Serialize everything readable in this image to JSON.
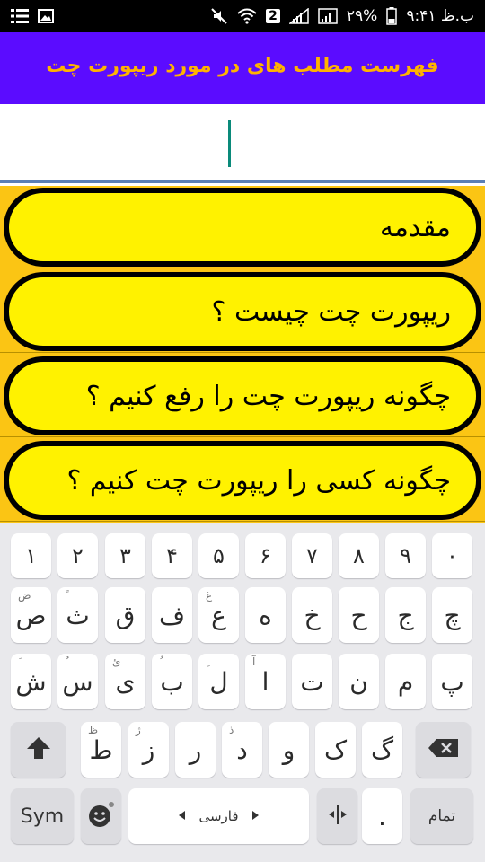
{
  "status_bar": {
    "time": "۹:۴۱ ب.ظ",
    "battery": "۲۹%",
    "sim_badge": "2"
  },
  "header": {
    "title": "فهرست مطلب های در مورد ریپورت چت"
  },
  "search": {
    "value": "",
    "placeholder": ""
  },
  "list": {
    "items": [
      {
        "label": "مقدمه"
      },
      {
        "label": "ریپورت چت چیست ؟"
      },
      {
        "label": "چگونه ریپورت چت را رفع کنیم ؟"
      },
      {
        "label": "چگونه کسی را ریپورت چت کنیم ؟"
      }
    ]
  },
  "keyboard": {
    "digits": [
      "۱",
      "۲",
      "۳",
      "۴",
      "۵",
      "۶",
      "۷",
      "۸",
      "۹",
      "۰"
    ],
    "row1": [
      {
        "main": "ص",
        "sub": "ض"
      },
      {
        "main": "ث",
        "sub": "ً"
      },
      {
        "main": "ق",
        "sub": ""
      },
      {
        "main": "ف",
        "sub": ""
      },
      {
        "main": "ع",
        "sub": "غ"
      },
      {
        "main": "ه",
        "sub": ""
      },
      {
        "main": "خ",
        "sub": ""
      },
      {
        "main": "ح",
        "sub": ""
      },
      {
        "main": "ج",
        "sub": ""
      },
      {
        "main": "چ",
        "sub": ""
      }
    ],
    "row2": [
      {
        "main": "ش",
        "sub": "َ"
      },
      {
        "main": "س",
        "sub": "ٌ"
      },
      {
        "main": "ی",
        "sub": "ئ"
      },
      {
        "main": "ب",
        "sub": "ُ"
      },
      {
        "main": "ل",
        "sub": "ِ"
      },
      {
        "main": "ا",
        "sub": "آ"
      },
      {
        "main": "ت",
        "sub": ""
      },
      {
        "main": "ن",
        "sub": ""
      },
      {
        "main": "م",
        "sub": ""
      },
      {
        "main": "پ",
        "sub": ""
      }
    ],
    "row3": [
      {
        "main": "ط",
        "sub": "ظ"
      },
      {
        "main": "ز",
        "sub": "ژ"
      },
      {
        "main": "ر",
        "sub": ""
      },
      {
        "main": "د",
        "sub": "ذ"
      },
      {
        "main": "و",
        "sub": ""
      },
      {
        "main": "ک",
        "sub": ""
      },
      {
        "main": "گ",
        "sub": ""
      }
    ],
    "sym_label": "Sym",
    "space_label": "فارسی",
    "period_label": ".",
    "done_label": "تمام"
  },
  "colors": {
    "title_bar": "#5b0cff",
    "title_text": "#ffb300",
    "list_background": "#fbc514",
    "pill_fill": "#fff200",
    "cursor": "#0a8a7a"
  }
}
